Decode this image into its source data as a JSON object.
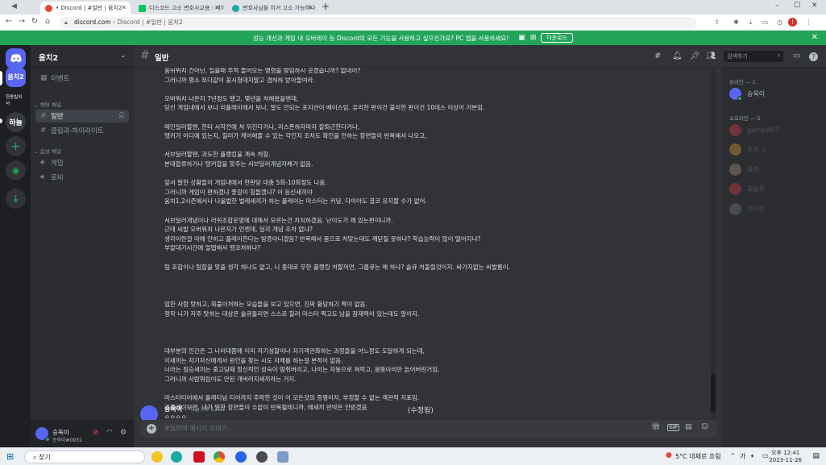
{
  "browser": {
    "tabs": [
      {
        "label": "• Discord | #일반 | 움치2",
        "active": true
      },
      {
        "label": "디스코드 고소 변호사교용 : 네이",
        "active": false
      },
      {
        "label": "변호사님들 이거 고소 가능하나",
        "active": false
      }
    ],
    "new_tab": "+",
    "url_host": "discord.com",
    "url_rest": " › Discord | #일반 | 움치2",
    "window_controls": [
      "–",
      "☐",
      "✕"
    ]
  },
  "banner": {
    "text": "성능 개선과 게임 내 오버레이 등 Discord의 모든 기능을 사용하고 싶으신가요? PC 앱을 사용하세요!",
    "download": "다운로드"
  },
  "guilds": [
    {
      "label": "",
      "icon": "discord-logo",
      "color": "#5865f2"
    },
    {
      "label": "움치2",
      "color": "#5865f2",
      "selected": true
    },
    {
      "label": "한동빌의서",
      "color": "#1e1f22"
    },
    {
      "label": "하늘",
      "color": "#36393f"
    },
    {
      "label": "+",
      "color": "#313338",
      "icon": "add-server"
    },
    {
      "label": "",
      "color": "#313338",
      "icon": "explore"
    },
    {
      "label": "",
      "color": "#313338",
      "icon": "download-apps"
    }
  ],
  "server": {
    "name": "움치2",
    "events": "이벤트",
    "text_category": "채팅 채널",
    "text_channels": [
      "일반",
      "클립과-하이라이트"
    ],
    "voice_category": "음성 채널",
    "voice_channels": [
      "게임",
      "로비"
    ]
  },
  "user": {
    "name": "승욱이",
    "tag": "승욱이#0931"
  },
  "header": {
    "channel": "일반",
    "search_placeholder": "검색하기"
  },
  "messages": {
    "lines": [
      "움뉘위치 긴아닌, 일을때 주먹 들어오는 명령을 방임하시 곳겠습니까? 없네어?",
      "그러니까 평소 쪼다같이 꽃시청대지말고 겸허하 받아들여라.",
      "",
      "오버워치 나온지 7년정도 됐고, 몇년을 처해왔을텐데,",
      "당신 게임내에서 보나 리플레이에서 보나, 말도 안되는 포지션이 베이스임. 유리한 판이건 불리한 판이건 10데스 이상이 기본임.",
      "",
      "메인딜러할땐, 한타 시작전에 쳐 뒤진다거나, 리스폰하자마자 칼퇴근한다거나,",
      "탱커가 어디에 있는지, 힐러가 케어해줄 수 있는 각인지 조차도 확인을 안하는 장면들이 반복해서 나오고,",
      "",
      "서브딜러할땐, 과도한 플랭킹을 계속 처함.",
      "본대합류하거나 탱커합을 맞추는 서브딜러개념자체가 없음.",
      "",
      "앞서 말한 상황들이 게임내에서 한판당 대충 5회-10회정도 나옴.",
      "그러니까 게임이 편하겠냐 좋갈이 힘들겠냐? 이 등신새끼야",
      "움치1,2시즌에서나 나올법한 벌레새끼가 하는 플레이는 마스터는 커녕, 다이아도 결코 유지할 수가 없어.",
      "",
      "서브딜러개념이나 러쉬조합운영에 대해서 모르는건 차치하겠음. 난이도가 꽤 있는편이니까.",
      "근데 씨발 오버워치 나온지가 언젠데, 딜각 개념 조차 없냐?",
      "생각이란걸 아예 안하고 플레이한다는 방증아니겠음? 반복해서 몸으로 처맞는데도 깨닫질 못하냐? 학습능력이 많이 떨어지냐?",
      "부랄대기시간에 얼탭해서 펭코처하냐?",
      "",
      "팀 조합이나 팀합을 맞출 생각 하나도 없고, 니 좆대로 무한 플랭킹 처할꺼면, 그룹큐는 왜 하냐? 솔큐 처돌릴것이지. 싸가지없는 씨발롬이.",
      "",
      "",
      "",
      "엄한 사람 탓하고, 화풀이처하는 모습들을 보고 있으면, 진짜 황당하기 짝이 없음.",
      "정작 니가 자주 탓하는 대상은 솔큐돌리면 스스로 힐러 마스터 찍고도 남을 잠재력이 있는데도 말이지.",
      "",
      "",
      "",
      "대부분의 인간은 그 나이대쯤에 이미 자기성찰이나 자기객관화하는 과정들을 어느정도 도달하게 되는데,",
      "이새끼는 자기자신에게서 원인을 찾는 시도 자체를 하는걸 본적이 없음.",
      "너라는 짐승새끼는 중고딩때 정신적인 성숙이 멈춰버리고, 나이는 자동으로 쳐먹고, 몸뚱아리만 늙어버린거임.",
      "그러니까 사람뭐림이도 안된 개버러지새끼라는 거지.",
      "",
      "마스터티어에서 플래티넘 티어까지 추락한 것이 이 모든것의 증명이자, 부정할 수 없는 객관적 지표임.",
      "리플레이보면, 내가 말한 장면들이 수없이 반복될테니까, 에새끼 반박은 안받겠음"
    ],
    "edited_label": "(수정됨)",
    "last_author": "승욱이",
    "last_time": "오늘 오후 12:21",
    "last_text": "ㅇㅇㅇㅇ"
  },
  "composer": {
    "placeholder": "#일반에 메시지 보내기",
    "gif": "GIF"
  },
  "members": {
    "online_header": "온라인 — 1",
    "online": [
      {
        "name": "승욱이",
        "color": "#5865f2"
      }
    ],
    "offline_header": "오프라인 — 5",
    "offline": [
      {
        "name": "gerrard07",
        "color": "#ed4245"
      },
      {
        "name": "우유 ☕",
        "color": "#f0b232"
      },
      {
        "name": "요진",
        "color": "#b9a389"
      },
      {
        "name": "최승우",
        "color": "#ed4245"
      },
      {
        "name": "킨나린",
        "color": "#80848e"
      }
    ]
  },
  "taskbar": {
    "search": "찾기",
    "weather": "5°C  대체로 흐림",
    "time": "오후 12:41",
    "date": "2023-11-26",
    "ime": "가"
  },
  "colors": {
    "accent": "#5865f2",
    "banner": "#23a559",
    "online": "#23a559"
  }
}
